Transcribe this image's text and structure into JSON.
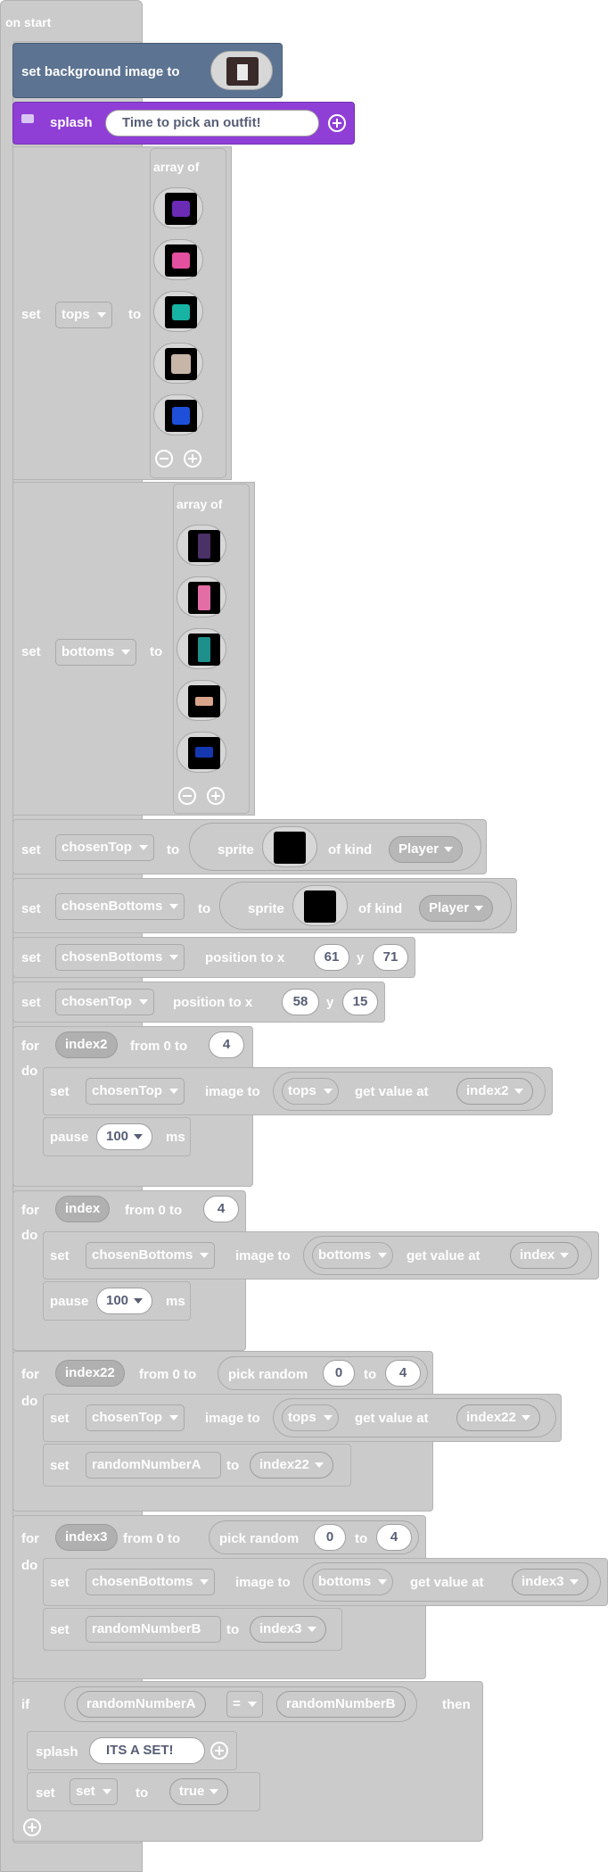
{
  "on_start": "on start",
  "bg": {
    "label": "set background image to"
  },
  "splash1": {
    "label": "splash",
    "text": "Time to pick an outfit!"
  },
  "common": {
    "set": "set",
    "to": "to",
    "array_of": "array of",
    "sprite": "sprite",
    "of_kind": "of kind",
    "position_to_x": "position to x",
    "y": "y",
    "for": "for",
    "from_0_to": "from 0 to",
    "do": "do",
    "image_to": "image to",
    "get_value_at": "get value at",
    "pause": "pause",
    "ms": "ms",
    "pick_random": "pick random",
    "if": "if",
    "then": "then",
    "eq": "="
  },
  "vars": {
    "tops": "tops",
    "bottoms": "bottoms",
    "chosenTop": "chosenTop",
    "chosenBottoms": "chosenBottoms",
    "index2": "index2",
    "index": "index",
    "index22": "index22",
    "index3": "index3",
    "randomNumberA": "randomNumberA",
    "randomNumberB": "randomNumberB",
    "set": "set"
  },
  "kind": "Player",
  "values": {
    "bx": "61",
    "by": "71",
    "tx": "58",
    "ty": "15",
    "four": "4",
    "zero": "0",
    "pause_ms": "100"
  },
  "splash2": {
    "text": "ITS A SET!"
  },
  "bool": "true",
  "colors": {
    "block_grey": "#cbcbcb",
    "scene_blue": "#5c7392",
    "splash_purple": "#8f3fd6",
    "top_purple": "#6b2bb5",
    "top_pink": "#e2509f",
    "top_teal": "#17b3a3",
    "top_beige": "#c7b6a8",
    "top_blue": "#1d4fd8",
    "bot_purple": "#4a3166",
    "bot_pink": "#e26ea5",
    "bot_teal": "#1e8f8b",
    "bot_beige": "#d8a58c",
    "bot_blue": "#1537b0"
  }
}
